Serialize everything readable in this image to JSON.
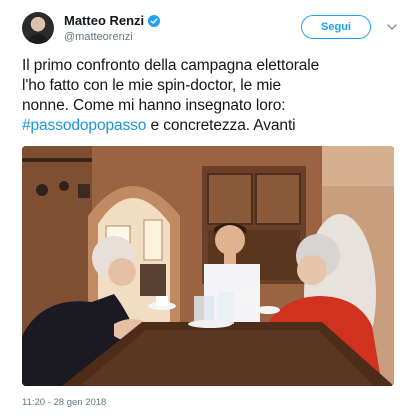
{
  "author": {
    "display_name": "Matteo Renzi",
    "handle": "@matteorenzi",
    "verified": true,
    "avatar_icon": "profile-photo"
  },
  "follow_button": {
    "label": "Segui"
  },
  "menu_icon": "chevron-down-icon",
  "tweet": {
    "lines": [
      "Il primo confronto della campagna elettorale",
      "l'ho fatto con le mie spin-doctor, le mie",
      "nonne. Come mi hanno insegnato loro:"
    ],
    "hashtag": "#passodopopasso",
    "last_line_rest": " e concretezza. Avanti"
  },
  "photo": {
    "subject": "three-people-at-table-photo"
  },
  "timestamp": "11:20 - 28 gen 2018",
  "colors": {
    "accent": "#1da1f2",
    "hashtag": "#1b95e0",
    "muted": "#657786"
  }
}
